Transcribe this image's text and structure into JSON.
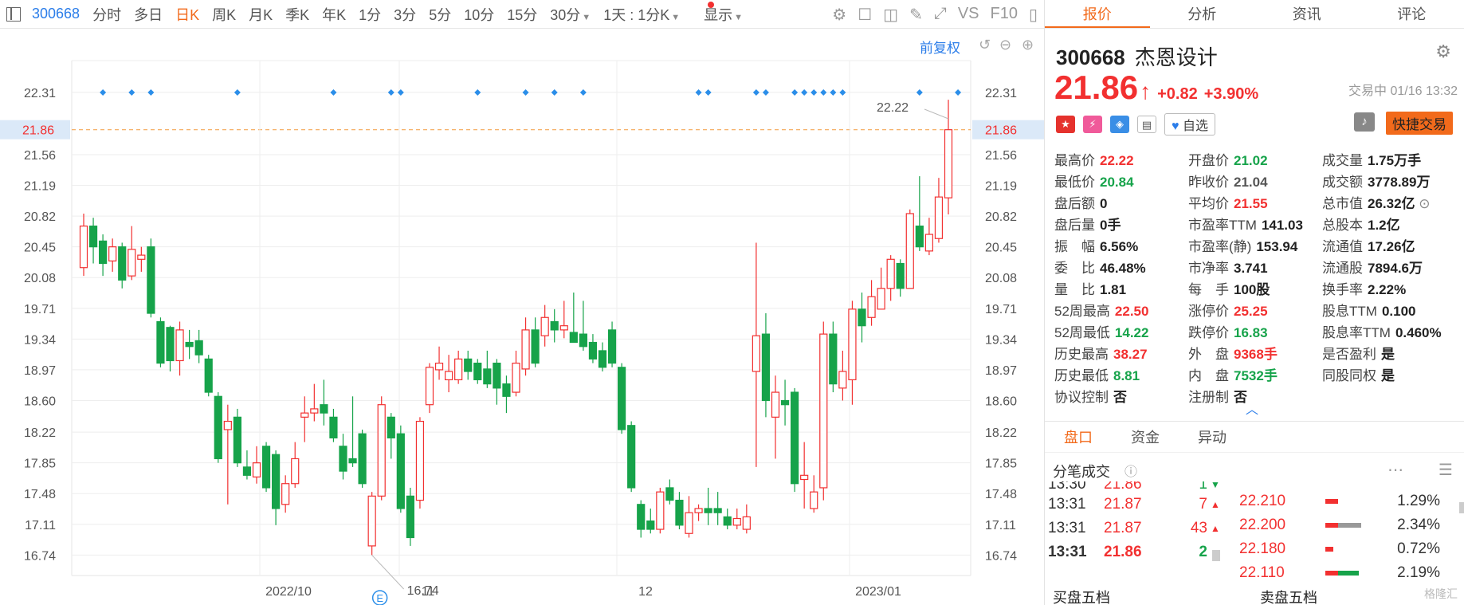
{
  "toolbar": {
    "code": "300668",
    "items": [
      "分时",
      "多日",
      "日K",
      "周K",
      "月K",
      "季K",
      "年K",
      "1分",
      "3分",
      "5分",
      "10分",
      "15分",
      "30分",
      "1天 : 1分K",
      "显示"
    ],
    "active_index": 2,
    "vs": "VS",
    "f10": "F10"
  },
  "chart": {
    "fq_label": "前复权",
    "y_ticks": [
      "22.31",
      "21.86",
      "21.56",
      "21.19",
      "20.82",
      "20.45",
      "20.08",
      "19.71",
      "19.34",
      "18.97",
      "18.60",
      "18.22",
      "17.85",
      "17.48",
      "17.11",
      "16.74"
    ],
    "x_labels": [
      "2022/10",
      "11",
      "12",
      "2023/01"
    ],
    "current_price_label": "21.86",
    "high_label": "22.22",
    "low_label": "16.74",
    "event_marker": "E",
    "colors": {
      "up": "#f23030",
      "down": "#16a34a",
      "grid": "#eeeeee",
      "dash": "#f39a3e",
      "diamond": "#2b8ee9"
    }
  },
  "chart_data": {
    "type": "candlestick",
    "ylim": [
      16.5,
      22.6
    ],
    "candles": [
      [
        20.2,
        20.7,
        20.85,
        20.1
      ],
      [
        20.7,
        20.45,
        20.8,
        20.25
      ],
      [
        20.52,
        20.25,
        20.6,
        20.1
      ],
      [
        20.28,
        20.45,
        20.55,
        20.15
      ],
      [
        20.45,
        20.05,
        20.5,
        19.95
      ],
      [
        20.1,
        20.42,
        20.7,
        20.05
      ],
      [
        20.3,
        20.35,
        20.45,
        20.15
      ],
      [
        20.45,
        19.65,
        20.55,
        19.6
      ],
      [
        19.55,
        19.05,
        19.6,
        19.0
      ],
      [
        19.48,
        19.08,
        19.5,
        18.95
      ],
      [
        19.08,
        19.45,
        19.55,
        18.9
      ],
      [
        19.3,
        19.25,
        19.45,
        19.1
      ],
      [
        19.32,
        19.15,
        19.45,
        19.05
      ],
      [
        19.1,
        18.7,
        19.15,
        18.65
      ],
      [
        18.65,
        17.9,
        18.7,
        17.85
      ],
      [
        18.25,
        18.35,
        18.55,
        17.35
      ],
      [
        18.4,
        17.85,
        18.5,
        17.8
      ],
      [
        17.8,
        17.7,
        18.0,
        17.65
      ],
      [
        17.68,
        17.85,
        18.05,
        17.6
      ],
      [
        18.05,
        17.55,
        18.1,
        17.5
      ],
      [
        17.95,
        17.3,
        18.0,
        17.1
      ],
      [
        17.35,
        17.6,
        17.7,
        17.25
      ],
      [
        17.6,
        17.9,
        18.1,
        17.55
      ],
      [
        18.4,
        18.45,
        18.65,
        18.1
      ],
      [
        18.45,
        18.5,
        18.8,
        18.35
      ],
      [
        18.55,
        18.45,
        18.85,
        18.3
      ],
      [
        18.4,
        18.15,
        18.5,
        18.1
      ],
      [
        18.05,
        17.75,
        18.2,
        17.65
      ],
      [
        17.9,
        17.85,
        18.65,
        17.8
      ],
      [
        18.2,
        17.6,
        18.25,
        17.55
      ],
      [
        16.85,
        17.45,
        17.5,
        16.74
      ],
      [
        17.45,
        18.55,
        18.65,
        17.4
      ],
      [
        18.4,
        18.15,
        18.45,
        17.9
      ],
      [
        18.2,
        17.3,
        18.3,
        17.25
      ],
      [
        17.45,
        16.95,
        17.55,
        16.85
      ],
      [
        17.4,
        18.35,
        18.4,
        17.3
      ],
      [
        18.55,
        19.0,
        19.05,
        18.45
      ],
      [
        18.97,
        19.05,
        19.25,
        18.85
      ],
      [
        18.85,
        18.95,
        19.15,
        18.7
      ],
      [
        18.85,
        19.1,
        19.2,
        18.8
      ],
      [
        19.1,
        18.95,
        19.2,
        18.85
      ],
      [
        19.05,
        18.85,
        19.1,
        18.8
      ],
      [
        18.98,
        18.8,
        19.2,
        18.75
      ],
      [
        19.05,
        18.75,
        19.1,
        18.55
      ],
      [
        18.8,
        18.65,
        18.9,
        18.45
      ],
      [
        18.7,
        19.05,
        19.2,
        18.65
      ],
      [
        18.98,
        19.45,
        19.6,
        18.9
      ],
      [
        19.45,
        19.05,
        19.6,
        19.0
      ],
      [
        19.38,
        19.6,
        19.75,
        19.25
      ],
      [
        19.55,
        19.45,
        19.7,
        19.3
      ],
      [
        19.45,
        19.5,
        19.8,
        19.35
      ],
      [
        19.42,
        19.3,
        19.9,
        19.3
      ],
      [
        19.4,
        19.25,
        19.8,
        19.2
      ],
      [
        19.3,
        19.1,
        19.4,
        19.05
      ],
      [
        19.2,
        19.0,
        19.3,
        18.95
      ],
      [
        19.45,
        19.05,
        19.55,
        19.0
      ],
      [
        19.0,
        18.25,
        19.05,
        18.2
      ],
      [
        18.3,
        17.55,
        18.35,
        17.5
      ],
      [
        17.35,
        17.05,
        17.4,
        16.95
      ],
      [
        17.15,
        17.05,
        17.3,
        17.0
      ],
      [
        17.05,
        17.5,
        17.55,
        17.0
      ],
      [
        17.55,
        17.4,
        17.65,
        17.35
      ],
      [
        17.4,
        17.1,
        17.5,
        17.05
      ],
      [
        17.0,
        17.25,
        17.45,
        16.95
      ],
      [
        17.25,
        17.3,
        17.35,
        17.15
      ],
      [
        17.3,
        17.25,
        17.55,
        17.1
      ],
      [
        17.3,
        17.25,
        17.5,
        17.1
      ],
      [
        17.2,
        17.1,
        17.3,
        17.05
      ],
      [
        17.1,
        17.18,
        17.3,
        17.05
      ],
      [
        17.05,
        17.2,
        17.35,
        17.0
      ],
      [
        18.95,
        19.38,
        20.5,
        17.8
      ],
      [
        19.4,
        18.6,
        19.65,
        18.4
      ],
      [
        18.4,
        18.7,
        18.9,
        17.9
      ],
      [
        18.6,
        18.55,
        18.85,
        18.3
      ],
      [
        18.7,
        17.6,
        18.75,
        17.5
      ],
      [
        17.65,
        17.7,
        18.1,
        17.3
      ],
      [
        17.3,
        17.5,
        17.7,
        17.25
      ],
      [
        17.55,
        19.4,
        19.55,
        17.4
      ],
      [
        19.4,
        18.8,
        19.55,
        18.7
      ],
      [
        18.75,
        18.95,
        19.2,
        18.6
      ],
      [
        18.85,
        19.7,
        19.8,
        18.55
      ],
      [
        19.7,
        19.5,
        19.9,
        19.3
      ],
      [
        19.6,
        19.85,
        20.05,
        19.5
      ],
      [
        19.7,
        19.95,
        20.2,
        19.75
      ],
      [
        19.95,
        20.3,
        20.35,
        19.8
      ],
      [
        20.25,
        19.95,
        20.3,
        19.85
      ],
      [
        19.95,
        20.85,
        20.9,
        19.95
      ],
      [
        20.7,
        20.45,
        21.3,
        20.4
      ],
      [
        20.4,
        20.6,
        20.8,
        20.35
      ],
      [
        20.55,
        21.05,
        21.28,
        20.5
      ],
      [
        21.04,
        21.86,
        22.22,
        20.84
      ]
    ]
  },
  "quote_tabs": [
    "报价",
    "分析",
    "资讯",
    "评论"
  ],
  "quote_active": 0,
  "stock": {
    "code": "300668",
    "name": "杰恩设计",
    "price": "21.86",
    "change": "+0.82",
    "change_pct": "+3.90%",
    "status": "交易中 01/16 13:32",
    "fav_label": "自选",
    "quick_trade": "快捷交易"
  },
  "stats": [
    [
      {
        "label": "最高价",
        "value": "22.22",
        "color": "red"
      },
      {
        "label": "开盘价",
        "value": "21.02",
        "color": "green"
      },
      {
        "label": "成交量",
        "value": "1.75万手",
        "color": ""
      }
    ],
    [
      {
        "label": "最低价",
        "value": "20.84",
        "color": "green"
      },
      {
        "label": "昨收价",
        "value": "21.04",
        "color": "gray"
      },
      {
        "label": "成交额",
        "value": "3778.89万",
        "color": ""
      }
    ],
    [
      {
        "label": "盘后额",
        "value": "0",
        "color": ""
      },
      {
        "label": "平均价",
        "value": "21.55",
        "color": "red"
      },
      {
        "label": "总市值",
        "value": "26.32亿",
        "color": ""
      }
    ],
    [
      {
        "label": "盘后量",
        "value": "0手",
        "color": ""
      },
      {
        "label": "市盈率TTM",
        "value": "141.03",
        "color": ""
      },
      {
        "label": "总股本",
        "value": "1.2亿",
        "color": ""
      }
    ],
    [
      {
        "label": "振　幅",
        "value": "6.56%",
        "color": ""
      },
      {
        "label": "市盈率(静)",
        "value": "153.94",
        "color": ""
      },
      {
        "label": "流通值",
        "value": "17.26亿",
        "color": ""
      }
    ],
    [
      {
        "label": "委　比",
        "value": "46.48%",
        "color": ""
      },
      {
        "label": "市净率",
        "value": "3.741",
        "color": ""
      },
      {
        "label": "流通股",
        "value": "7894.6万",
        "color": ""
      }
    ],
    [
      {
        "label": "量　比",
        "value": "1.81",
        "color": ""
      },
      {
        "label": "每　手",
        "value": "100股",
        "color": ""
      },
      {
        "label": "换手率",
        "value": "2.22%",
        "color": ""
      }
    ],
    [
      {
        "label": "52周最高",
        "value": "22.50",
        "color": "red"
      },
      {
        "label": "涨停价",
        "value": "25.25",
        "color": "red"
      },
      {
        "label": "股息TTM",
        "value": "0.100",
        "color": ""
      }
    ],
    [
      {
        "label": "52周最低",
        "value": "14.22",
        "color": "green"
      },
      {
        "label": "跌停价",
        "value": "16.83",
        "color": "green"
      },
      {
        "label": "股息率TTM",
        "value": "0.460%",
        "color": ""
      }
    ],
    [
      {
        "label": "历史最高",
        "value": "38.27",
        "color": "red"
      },
      {
        "label": "外　盘",
        "value": "9368手",
        "color": "red"
      },
      {
        "label": "是否盈利",
        "value": "是",
        "color": ""
      }
    ],
    [
      {
        "label": "历史最低",
        "value": "8.81",
        "color": "green"
      },
      {
        "label": "内　盘",
        "value": "7532手",
        "color": "green"
      },
      {
        "label": "同股同权",
        "value": "是",
        "color": ""
      }
    ],
    [
      {
        "label": "协议控制",
        "value": "否",
        "color": ""
      },
      {
        "label": "注册制",
        "value": "否",
        "color": ""
      },
      {
        "label": "",
        "value": "",
        "color": ""
      }
    ]
  ],
  "sub_tabs": [
    "盘口",
    "资金",
    "异动"
  ],
  "sub_active": 0,
  "fenbi": {
    "title": "分笔成交",
    "ticks": [
      {
        "t": "13:30",
        "p": "21.86",
        "v": "1",
        "dir": "down"
      },
      {
        "t": "13:31",
        "p": "21.87",
        "v": "7",
        "dir": "up"
      },
      {
        "t": "13:31",
        "p": "21.87",
        "v": "43",
        "dir": "up"
      },
      {
        "t": "13:31",
        "p": "21.86",
        "v": "2",
        "dir": "down"
      }
    ],
    "depth": [
      {
        "p": "22.210",
        "pct": "1.29%",
        "r": 0.25,
        "g": 0
      },
      {
        "p": "22.200",
        "pct": "2.34%",
        "r": 0.25,
        "g": 0.45
      },
      {
        "p": "22.180",
        "pct": "0.72%",
        "r": 0.15,
        "g": 0
      },
      {
        "p": "22.110",
        "pct": "2.19%",
        "r": 0.25,
        "g": 0.4
      }
    ]
  },
  "book": {
    "buy": "买盘五档",
    "sell": "卖盘五档"
  },
  "watermark": "格隆汇"
}
